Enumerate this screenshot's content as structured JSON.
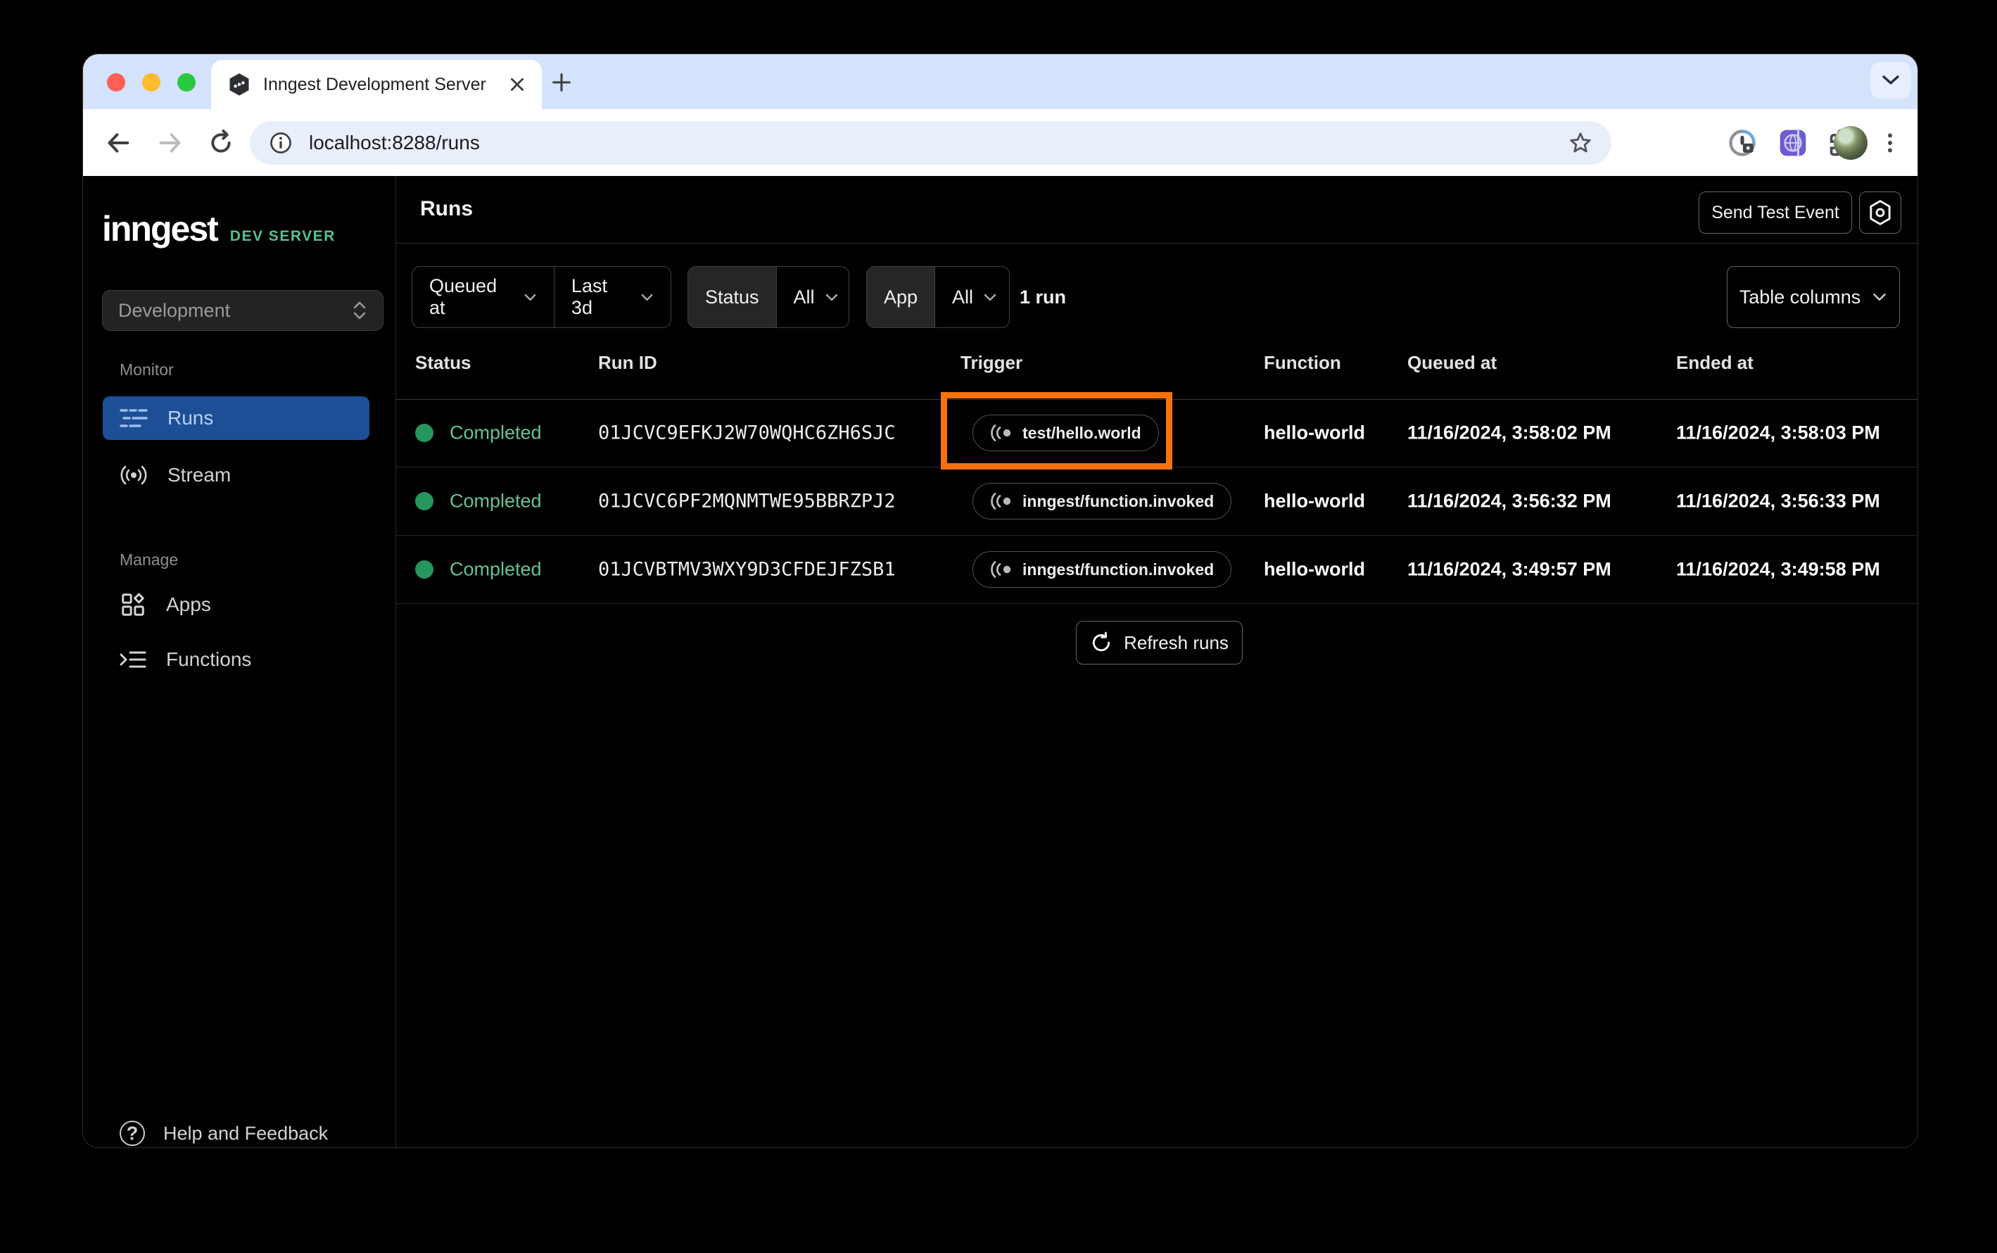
{
  "browser": {
    "tab_title": "Inngest Development Server",
    "url": "localhost:8288/runs"
  },
  "sidebar": {
    "logo": "inngest",
    "badge": "DEV SERVER",
    "environment": "Development",
    "monitor_label": "Monitor",
    "manage_label": "Manage",
    "runs_label": "Runs",
    "stream_label": "Stream",
    "apps_label": "Apps",
    "functions_label": "Functions",
    "help_label": "Help and Feedback"
  },
  "header": {
    "title": "Runs",
    "send_test_event": "Send Test Event"
  },
  "filters": {
    "field": "Queued at",
    "range": "Last 3d",
    "status_label": "Status",
    "status_value": "All",
    "app_label": "App",
    "app_value": "All",
    "result_count": "1 run",
    "table_columns": "Table columns"
  },
  "table": {
    "columns": [
      "Status",
      "Run ID",
      "Trigger",
      "Function",
      "Queued at",
      "Ended at"
    ],
    "rows": [
      {
        "status": "Completed",
        "run_id": "01JCVC9EFKJ2W70WQHC6ZH6SJC",
        "trigger": "test/hello.world",
        "function": "hello-world",
        "queued_at": "11/16/2024, 3:58:02 PM",
        "ended_at": "11/16/2024, 3:58:03 PM",
        "highlighted": true
      },
      {
        "status": "Completed",
        "run_id": "01JCVC6PF2MQNMTWE95BBRZPJ2",
        "trigger": "inngest/function.invoked",
        "function": "hello-world",
        "queued_at": "11/16/2024, 3:56:32 PM",
        "ended_at": "11/16/2024, 3:56:33 PM",
        "highlighted": false
      },
      {
        "status": "Completed",
        "run_id": "01JCVBTMV3WXY9D3CFDEJFZSB1",
        "trigger": "inngest/function.invoked",
        "function": "hello-world",
        "queued_at": "11/16/2024, 3:49:57 PM",
        "ended_at": "11/16/2024, 3:49:58 PM",
        "highlighted": false
      }
    ],
    "refresh_label": "Refresh runs"
  },
  "colors": {
    "accent_blue": "#1c4f96",
    "annotation_orange": "#f4720d",
    "status_green": "#27965c",
    "brand_green": "#57c08e",
    "tab_strip": "#d4e2fc"
  }
}
